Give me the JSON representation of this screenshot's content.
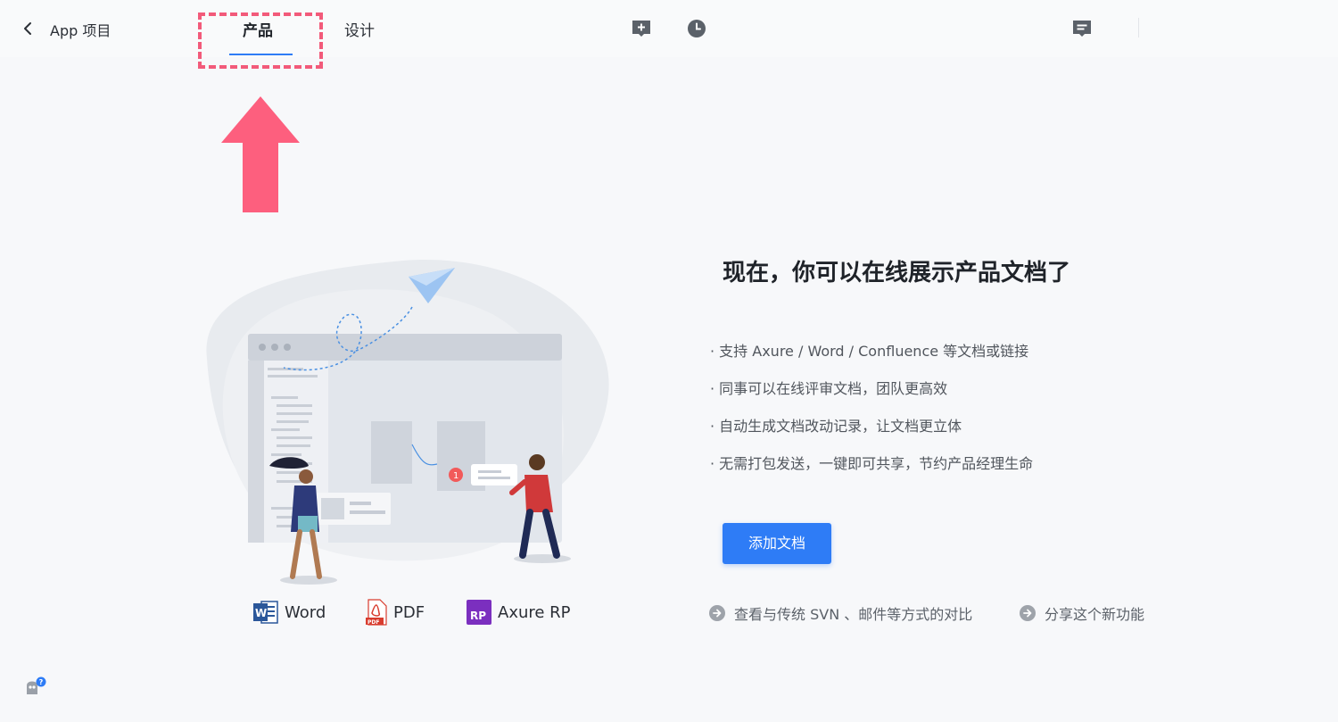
{
  "header": {
    "project_title": "App 项目",
    "tabs": [
      {
        "label": "产品",
        "active": true
      },
      {
        "label": "设计",
        "active": false
      }
    ],
    "icons": [
      "add-comment-icon",
      "history-icon",
      "message-icon"
    ]
  },
  "illustration": {
    "formats": [
      {
        "label": "Word",
        "icon": "word-icon"
      },
      {
        "label": "PDF",
        "icon": "pdf-icon"
      },
      {
        "label": "Axure RP",
        "icon": "axure-icon"
      }
    ]
  },
  "main": {
    "headline": "现在，你可以在线展示产品文档了",
    "features": [
      "· 支持 Axure / Word / Confluence 等文档或链接",
      "· 同事可以在线评审文档，团队更高效",
      "· 自动生成文档改动记录，让文档更立体",
      "· 无需打包发送，一键即可共享，节约产品经理生命"
    ],
    "add_button": "添加文档",
    "links": {
      "compare": "查看与传统 SVN 、邮件等方式的对比",
      "share": "分享这个新功能"
    }
  },
  "colors": {
    "accent": "#2e7cf6",
    "annotation": "#f25a7a",
    "icon_gray": "#5b6169"
  }
}
